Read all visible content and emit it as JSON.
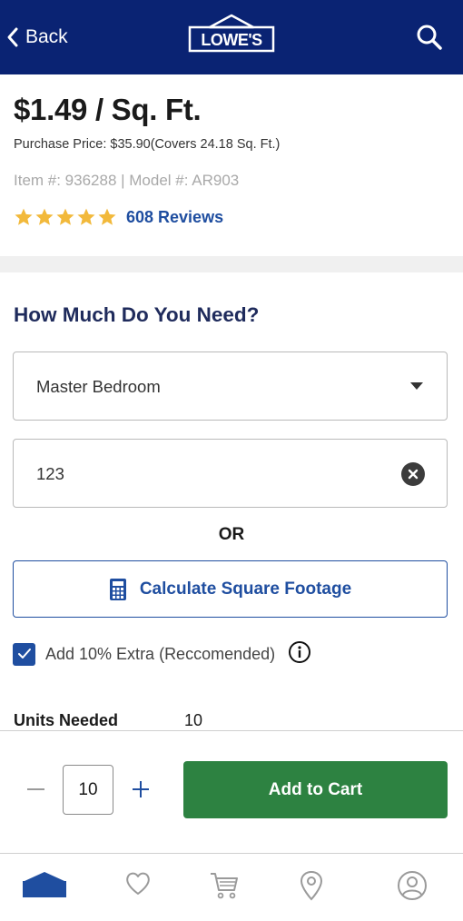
{
  "header": {
    "back_label": "Back",
    "logo_text": "LOWE'S",
    "brand_color": "#0a2373"
  },
  "product": {
    "unit_price": "$1.49 / Sq. Ft.",
    "purchase_price": "Purchase Price: $35.90(Covers 24.18 Sq. Ft.)",
    "item_model": "Item #: 936288 | Model #: AR903",
    "rating_stars": 5,
    "reviews_label": "608 Reviews"
  },
  "calculator": {
    "heading": "How Much Do You Need?",
    "room_select_value": "Master Bedroom",
    "sqft_input_value": "123",
    "or_label": "OR",
    "calculate_button_label": "Calculate Square Footage",
    "extra_checkbox_label": "Add 10% Extra (Reccomended)",
    "extra_checked": true,
    "units_needed_label": "Units Needed",
    "units_needed_value": "10"
  },
  "cart": {
    "quantity": "10",
    "add_to_cart_label": "Add to Cart",
    "add_color": "#2d8241"
  },
  "tabbar": {
    "items": [
      {
        "icon": "home-icon",
        "active": true
      },
      {
        "icon": "heart-icon",
        "active": false
      },
      {
        "icon": "cart-icon",
        "active": false
      },
      {
        "icon": "location-icon",
        "active": false
      },
      {
        "icon": "account-icon",
        "active": false
      }
    ]
  },
  "colors": {
    "accent_blue": "#1f4ea0",
    "star_gold": "#f2b93b"
  }
}
